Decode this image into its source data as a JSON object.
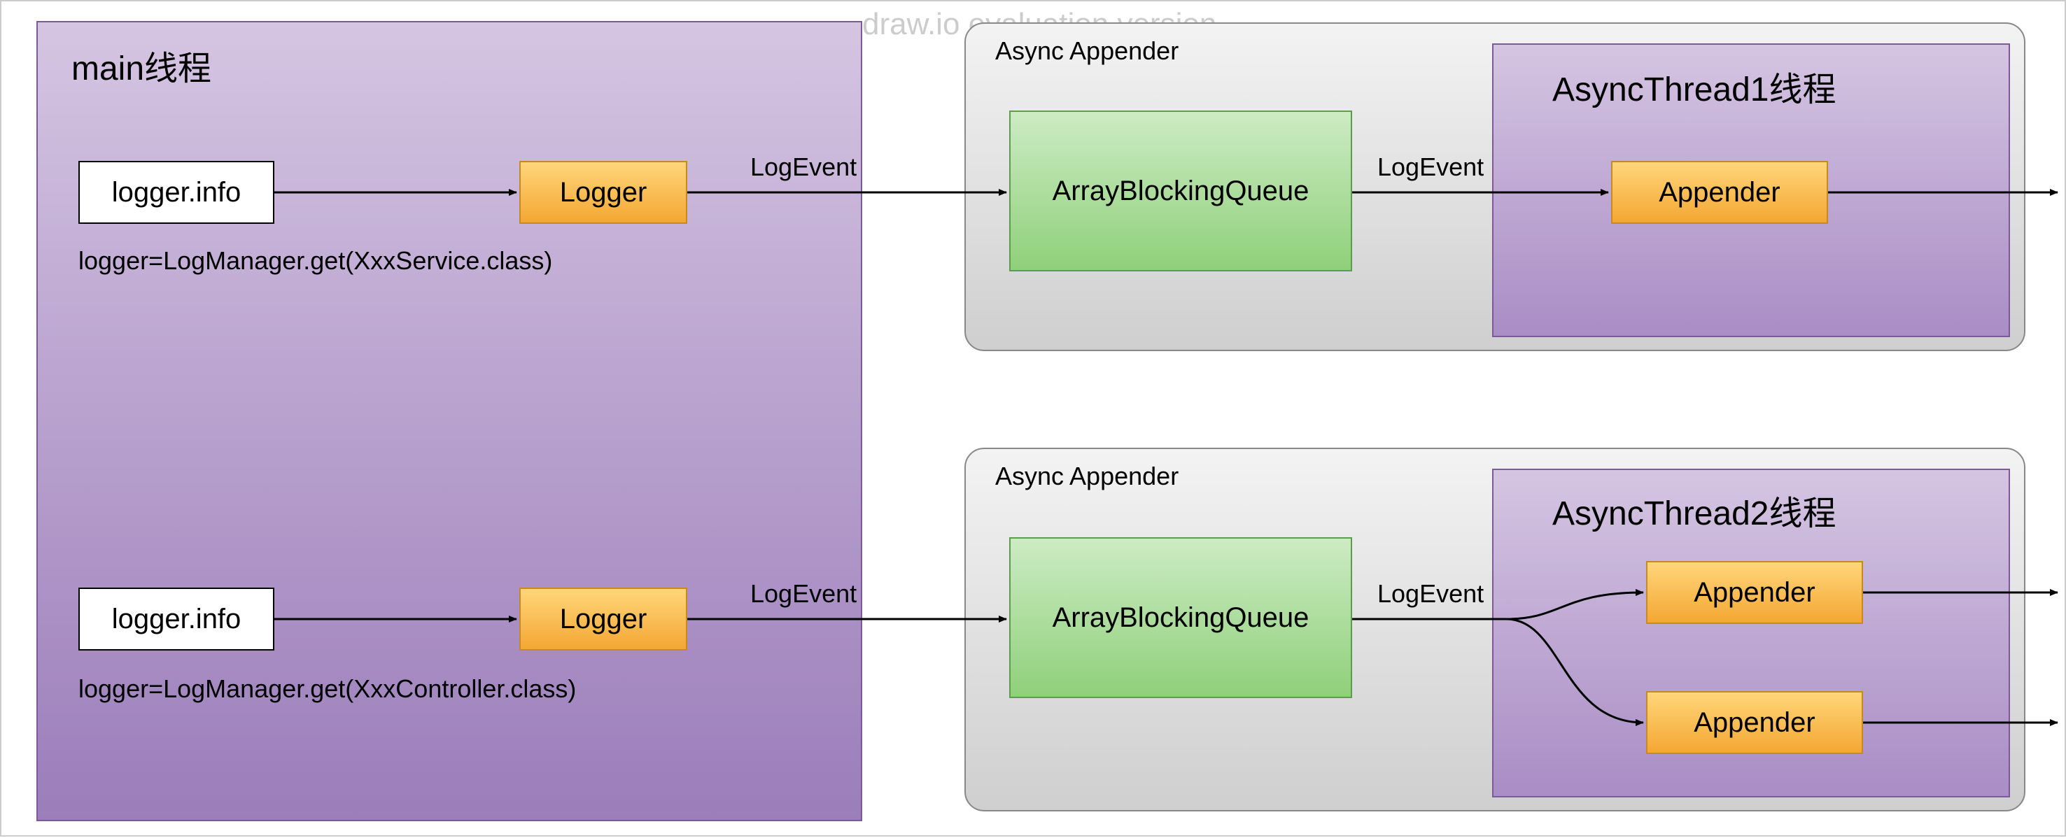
{
  "watermark": "draw.io evaluation version",
  "main": {
    "title": "main线程",
    "row1": {
      "call": "logger.info",
      "logger": "Logger",
      "sub": "logger=LogManager.get(XxxService.class)"
    },
    "row2": {
      "call": "logger.info",
      "logger": "Logger",
      "sub": "logger=LogManager.get(XxxController.class)"
    }
  },
  "edge": {
    "logevent": "LogEvent"
  },
  "async1": {
    "title": "Async Appender",
    "queue": "ArrayBlockingQueue",
    "thread": {
      "title": "AsyncThread1线程",
      "appender": "Appender"
    }
  },
  "async2": {
    "title": "Async Appender",
    "queue": "ArrayBlockingQueue",
    "thread": {
      "title": "AsyncThread2线程",
      "appender1": "Appender",
      "appender2": "Appender"
    }
  }
}
